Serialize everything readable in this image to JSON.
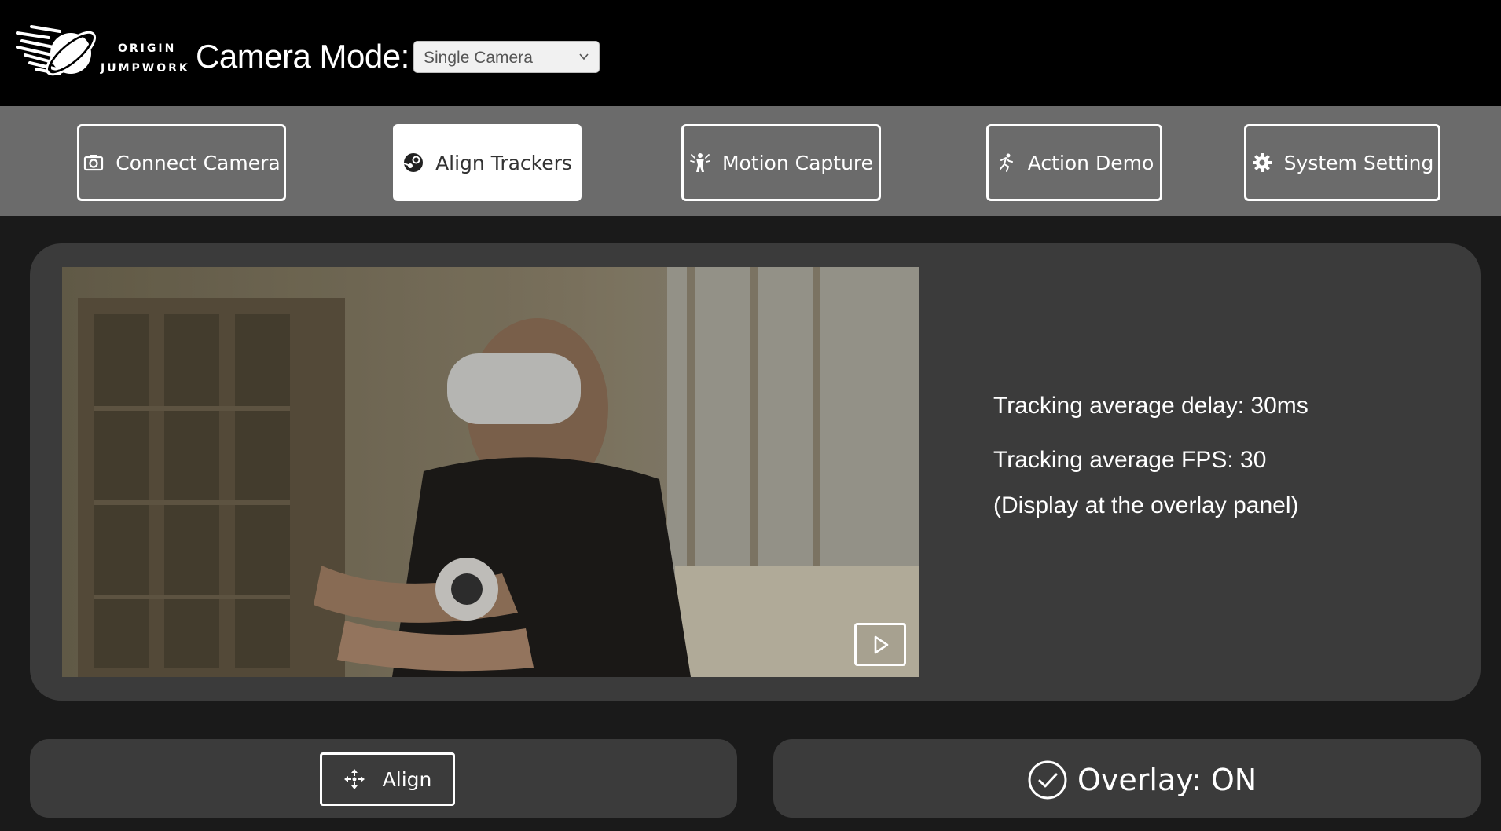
{
  "header": {
    "logo_line1": "ORIGIN",
    "logo_line2": "JUMPWORK",
    "camera_mode_label": "Camera Mode:",
    "camera_mode_value": "Single Camera"
  },
  "nav": {
    "connect_camera": "Connect Camera",
    "align_trackers": "Align Trackers",
    "motion_capture": "Motion Capture",
    "action_demo": "Action Demo",
    "system_setting": "System Setting",
    "active_tab": "Align Trackers"
  },
  "stats": {
    "delay": "Tracking average delay: 30ms",
    "fps": "Tracking average FPS: 30",
    "note": "(Display at the overlay panel)"
  },
  "actions": {
    "align_label": "Align",
    "overlay_label": "Overlay: ON"
  },
  "colors": {
    "topbar": "#000000",
    "navbar": "#6b6b6b",
    "panel": "#3b3b3b",
    "background": "#1a1a1a",
    "text": "#ffffff"
  },
  "icons": {
    "connect_camera": "camera-icon",
    "align_trackers": "steam-icon",
    "motion_capture": "person-motion-icon",
    "action_demo": "running-icon",
    "system_setting": "gear-icon",
    "align": "move-arrows-icon",
    "overlay": "check-circle-icon",
    "video": "play-icon"
  }
}
